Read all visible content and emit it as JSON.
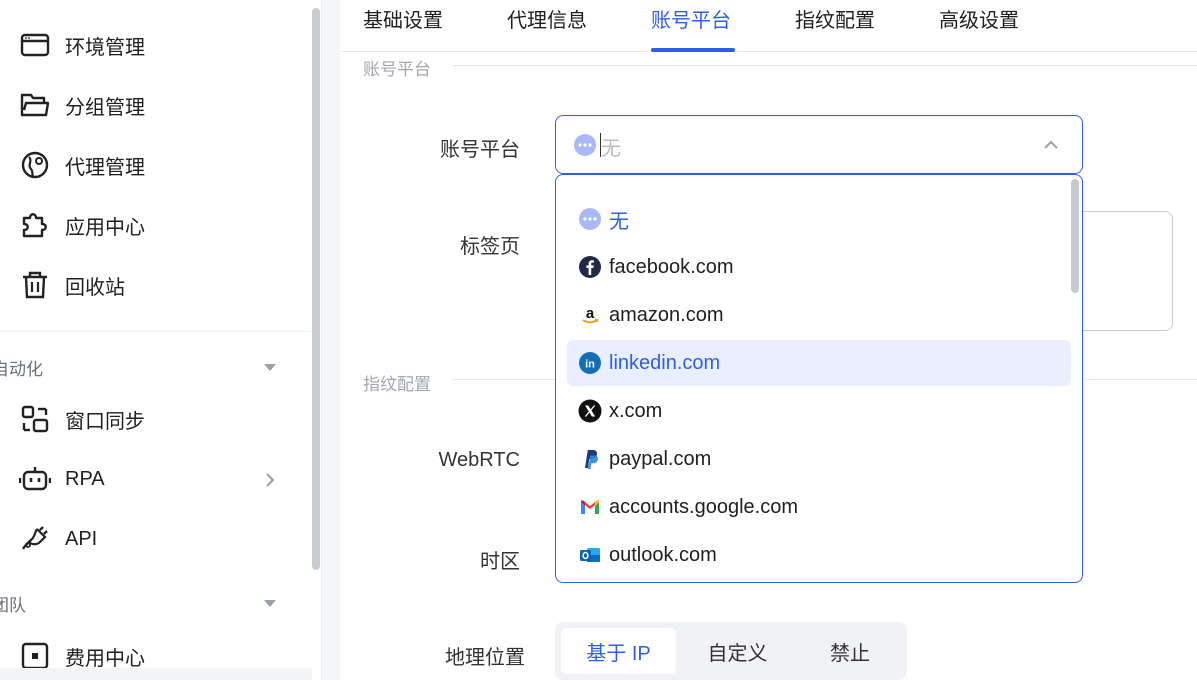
{
  "sidebar": {
    "items": [
      {
        "label": "环境管理",
        "icon": "browser-window-icon"
      },
      {
        "label": "分组管理",
        "icon": "folder-icon"
      },
      {
        "label": "代理管理",
        "icon": "globe-pin-icon"
      },
      {
        "label": "应用中心",
        "icon": "puzzle-icon"
      },
      {
        "label": "回收站",
        "icon": "trash-icon"
      }
    ],
    "section_automation": "自动化",
    "automation_items": [
      {
        "label": "窗口同步",
        "icon": "window-sync-icon"
      },
      {
        "label": "RPA",
        "icon": "robot-icon"
      },
      {
        "label": "API",
        "icon": "plug-icon"
      }
    ],
    "section_team": "团队",
    "team_items": [
      {
        "label": "费用中心",
        "icon": "billing-icon"
      }
    ]
  },
  "tabs": [
    "基础设置",
    "代理信息",
    "账号平台",
    "指纹配置",
    "高级设置"
  ],
  "active_tab": "账号平台",
  "groups": {
    "account_platform": "账号平台",
    "fingerprint": "指纹配置"
  },
  "form": {
    "account_platform_label": "账号平台",
    "account_platform_value": "无",
    "tabs_label": "标签页",
    "webrtc_label": "WebRTC",
    "timezone_label": "时区",
    "geolocation_label": "地理位置"
  },
  "dropdown": {
    "options": [
      {
        "label": "无",
        "icon": "none-dots-icon"
      },
      {
        "label": "facebook.com",
        "icon": "facebook-icon"
      },
      {
        "label": "amazon.com",
        "icon": "amazon-icon"
      },
      {
        "label": "linkedin.com",
        "icon": "linkedin-icon"
      },
      {
        "label": "x.com",
        "icon": "x-icon"
      },
      {
        "label": "paypal.com",
        "icon": "paypal-icon"
      },
      {
        "label": "accounts.google.com",
        "icon": "gmail-icon"
      },
      {
        "label": "outlook.com",
        "icon": "outlook-icon"
      }
    ],
    "selected": "无",
    "highlighted": "linkedin.com"
  },
  "geolocation_options": [
    "基于 IP",
    "自定义",
    "禁止"
  ],
  "geolocation_selected": "基于 IP",
  "colors": {
    "accent": "#2f5ee8",
    "hover_bg": "#e9efff",
    "border": "#e6e8ec"
  }
}
